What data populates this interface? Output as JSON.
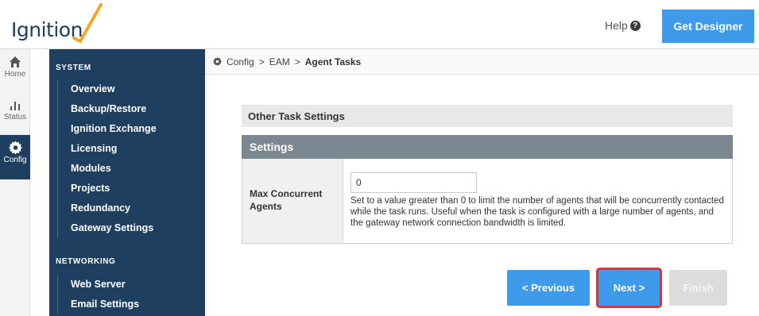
{
  "header": {
    "logo_text": "Ignition",
    "help_label": "Help",
    "help_icon": "question-circle-icon",
    "get_designer_label": "Get Designer"
  },
  "rail": [
    {
      "label": "Home",
      "icon": "home-icon",
      "glyph": "⌂"
    },
    {
      "label": "Status",
      "icon": "bar-chart-icon",
      "glyph": "▁▃▅"
    },
    {
      "label": "Config",
      "icon": "gear-icon",
      "glyph": "⚙",
      "active": true
    }
  ],
  "sidebar": {
    "system_title": "SYSTEM",
    "system_items": [
      "Overview",
      "Backup/Restore",
      "Ignition Exchange",
      "Licensing",
      "Modules",
      "Projects",
      "Redundancy",
      "Gateway Settings"
    ],
    "networking_title": "NETWORKING",
    "networking_items": [
      "Web Server",
      "Email Settings"
    ]
  },
  "breadcrumb": {
    "icon": "gear-icon",
    "items": [
      "Config",
      "EAM",
      "Agent Tasks"
    ],
    "separator": ">"
  },
  "main": {
    "panel_title": "Other Task Settings",
    "settings_header": "Settings",
    "field_label": "Max Concurrent Agents",
    "field_value": "0",
    "field_description": "Set to a value greater than 0 to limit the number of agents that will be concurrently contacted while the task runs. Useful when the task is configured with a large number of agents, and the gateway network connection bandwidth is limited."
  },
  "buttons": {
    "previous_label": "< Previous",
    "next_label": "Next >",
    "finish_label": "Finish"
  },
  "colors": {
    "accent": "#3d9be9",
    "sidebar_bg": "#1f3f60",
    "highlight_border": "#d9333f",
    "logo_swoosh": "#f5a623"
  }
}
